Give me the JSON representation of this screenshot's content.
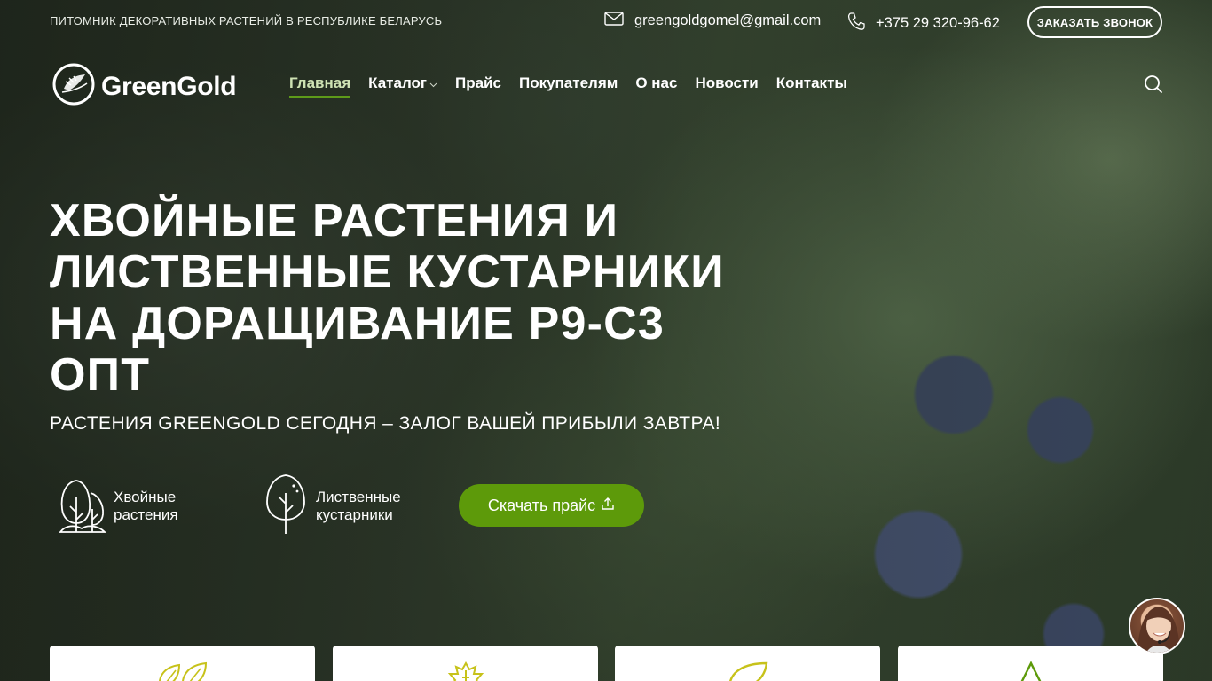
{
  "topbar": {
    "tagline": "ПИТОМНИК ДЕКОРАТИВНЫХ РАСТЕНИЙ В РЕСПУБЛИКЕ БЕЛАРУСЬ",
    "email": "greengoldgomel@gmail.com",
    "phone": "+375 29 320-96-62",
    "callback_label": "ЗАКАЗАТЬ ЗВОНОК"
  },
  "logo": {
    "text": "GreenGold"
  },
  "nav": {
    "items": [
      {
        "label": "Главная"
      },
      {
        "label": "Каталог"
      },
      {
        "label": "Прайс"
      },
      {
        "label": "Покупателям"
      },
      {
        "label": "О нас"
      },
      {
        "label": "Новости"
      },
      {
        "label": "Контакты"
      }
    ]
  },
  "hero": {
    "title_lines": [
      "ХВОЙНЫЕ РАСТЕНИЯ И",
      "ЛИСТВЕННЫЕ КУСТАРНИКИ",
      "НА ДОРАЩИВАНИЕ Р9-С3",
      "ОПТ"
    ],
    "subtitle": "РАСТЕНИЯ GREENGOLD СЕГОДНЯ – ЗАЛОГ ВАШЕЙ ПРИБЫЛИ ЗАВТРА!",
    "categories": [
      {
        "line1": "Хвойные",
        "line2": "растения",
        "icon": "conifer-icon"
      },
      {
        "line1": "Лиственные",
        "line2": "кустарники",
        "icon": "deciduous-tree-icon"
      }
    ],
    "price_button": "Скачать прайс"
  },
  "colors": {
    "accent_green": "#5d9a0a",
    "card_icon_gold": "#c7c21a"
  },
  "cards": [
    {
      "icon": "leaves-icon"
    },
    {
      "icon": "maple-leaf-icon"
    },
    {
      "icon": "leaf-icon"
    },
    {
      "icon": "fir-tree-icon"
    }
  ]
}
